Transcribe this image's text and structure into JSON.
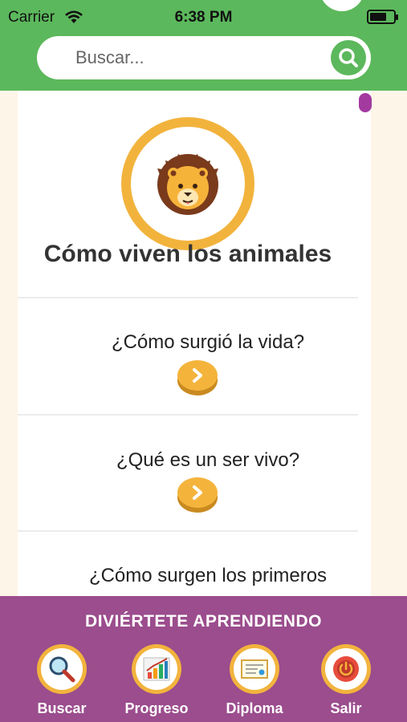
{
  "status_bar": {
    "carrier": "Carrier",
    "time": "6:38 PM"
  },
  "search": {
    "placeholder": "Buscar...",
    "button_icon": "search-icon"
  },
  "main": {
    "title": "Cómo viven los animales",
    "hero_icon": "lion-icon",
    "topics": [
      {
        "label": "¿Cómo surgió la vida?"
      },
      {
        "label": "¿Qué es un ser vivo?"
      },
      {
        "label": "¿Cómo surgen los primeros"
      }
    ]
  },
  "bottom": {
    "title": "DIVIÉRTETE APRENDIENDO",
    "nav": [
      {
        "label": "Buscar",
        "icon": "magnifier-icon"
      },
      {
        "label": "Progreso",
        "icon": "chart-icon"
      },
      {
        "label": "Diploma",
        "icon": "diploma-icon"
      },
      {
        "label": "Salir",
        "icon": "power-icon"
      }
    ]
  },
  "colors": {
    "header": "#5cb85c",
    "accent": "#f2b33d",
    "bottom": "#9b4d8d",
    "scroll": "#a33aa0"
  }
}
